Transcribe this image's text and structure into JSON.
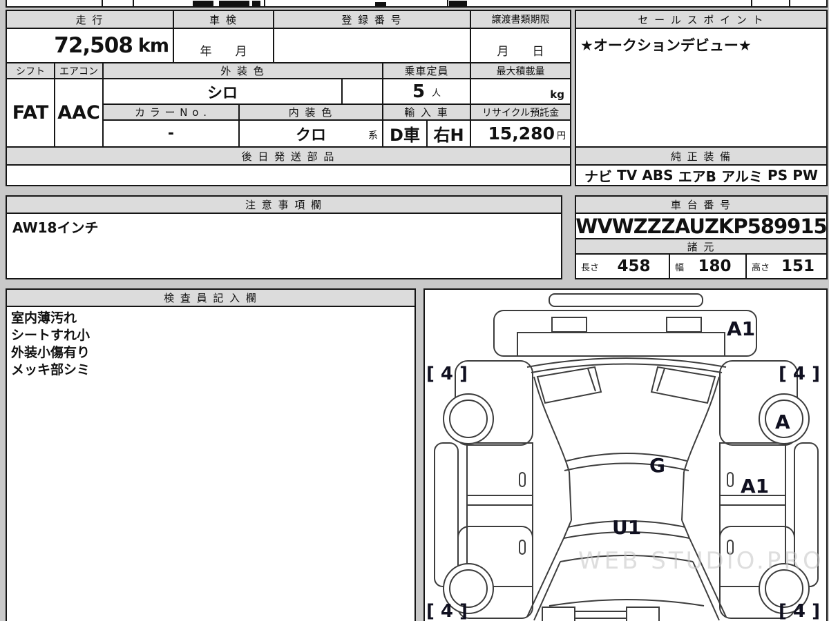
{
  "sheet": {
    "mileage": {
      "label": "走 行",
      "value": "72,508",
      "unit": "km"
    },
    "inspection": {
      "label": "車 検",
      "value": "年　　月"
    },
    "registration": {
      "label": "登 録 番 号",
      "value": ""
    },
    "transfer": {
      "label": "譲渡書類期限",
      "value": "月　　日"
    },
    "shift": {
      "label": "シフト",
      "value": "FAT"
    },
    "aircon": {
      "label": "エアコン",
      "value": "AAC"
    },
    "exterior_color": {
      "label": "外 装 色",
      "value": "シロ"
    },
    "capacity": {
      "label": "乗車定員",
      "value": "5",
      "unit": "人"
    },
    "max_load": {
      "label": "最大積載量",
      "value": "",
      "unit": "kg"
    },
    "color_no": {
      "label": "カ ラ ー N o .",
      "value": "-"
    },
    "interior_color": {
      "label": "内 装 色",
      "value": "クロ",
      "suffix": "系"
    },
    "import_car": {
      "label": "輸 入 車",
      "type": "D車",
      "handle": "右H"
    },
    "recycle_fee": {
      "label": "リサイクル預託金",
      "value": "15,280",
      "unit": "円"
    },
    "later_parts": {
      "label": "後 日 発 送 部 品",
      "value": ""
    },
    "sales_point": {
      "label": "セ ー ル ス ポ イ ン ト",
      "value": "★オークションデビュー★"
    },
    "equipment": {
      "label": "純 正 装 備",
      "items": [
        "ナビ",
        "TV",
        "ABS",
        "エアB",
        "アルミ",
        "PS",
        "PW"
      ]
    },
    "notes": {
      "label": "注 意 事 項 欄",
      "value": "AW18インチ"
    },
    "chassis": {
      "label": "車 台 番 号",
      "value": "WVWZZZAUZKP589915"
    },
    "dimensions": {
      "label": "諸 元",
      "length_label": "長さ",
      "length": "458",
      "width_label": "幅",
      "width": "180",
      "height_label": "高さ",
      "height": "151"
    },
    "inspector": {
      "label": "検 査 員 記 入 欄",
      "lines": [
        "室内薄汚れ",
        "シートすれ小",
        "外装小傷有り",
        "メッキ部シミ"
      ]
    },
    "diagram": {
      "a1_rear": "A1",
      "four_rear_left": "[ 4 ]",
      "four_rear_right": "[ 4 ]",
      "a_right_wheel": "A",
      "g_center": "G",
      "a1_right_door": "A1",
      "u1_center": "U1",
      "four_front_left": "[ 4 ]",
      "four_front_right": "[ 4 ]",
      "watermark": "WEB STUDIO.PRO"
    }
  }
}
